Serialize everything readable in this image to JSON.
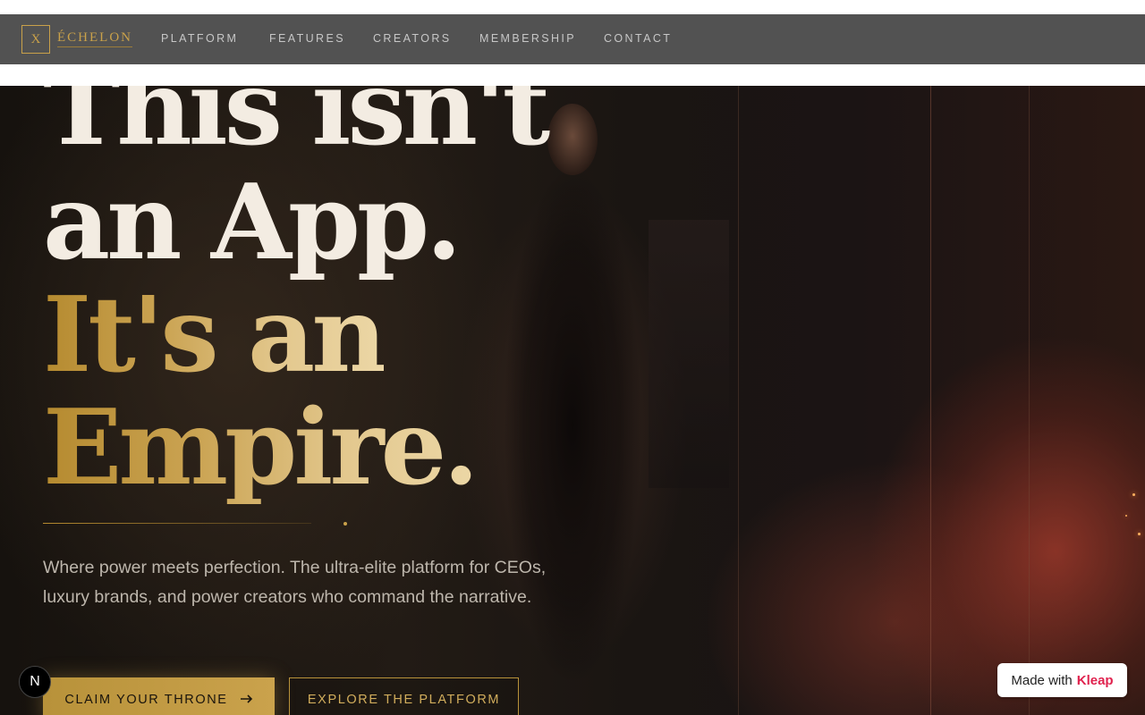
{
  "brand": {
    "mark": "X",
    "name": "ÉCHELON"
  },
  "nav": {
    "items": [
      {
        "label": "PLATFORM"
      },
      {
        "label": "FEATURES"
      },
      {
        "label": "CREATORS"
      },
      {
        "label": "MEMBERSHIP"
      },
      {
        "label": "CONTACT"
      }
    ]
  },
  "hero": {
    "line1": "This isn't",
    "line2": "an App.",
    "line3": "It's an",
    "line4": "Empire.",
    "subtext": "Where power meets perfection. The ultra-elite platform for CEOs, luxury brands, and power creators who command the narrative.",
    "primary_cta": "CLAIM YOUR THRONE",
    "primary_cta_icon": "arrow-right-icon",
    "secondary_cta": "EXPLORE THE PLATFORM"
  },
  "badges": {
    "n_badge": "N",
    "made_with": "Made with",
    "made_with_brand": "Kleap"
  },
  "colors": {
    "gold": "#c9a14a",
    "cream": "#f3ece2",
    "nav_bg": "#525252",
    "kleap_pink": "#e0224e"
  }
}
